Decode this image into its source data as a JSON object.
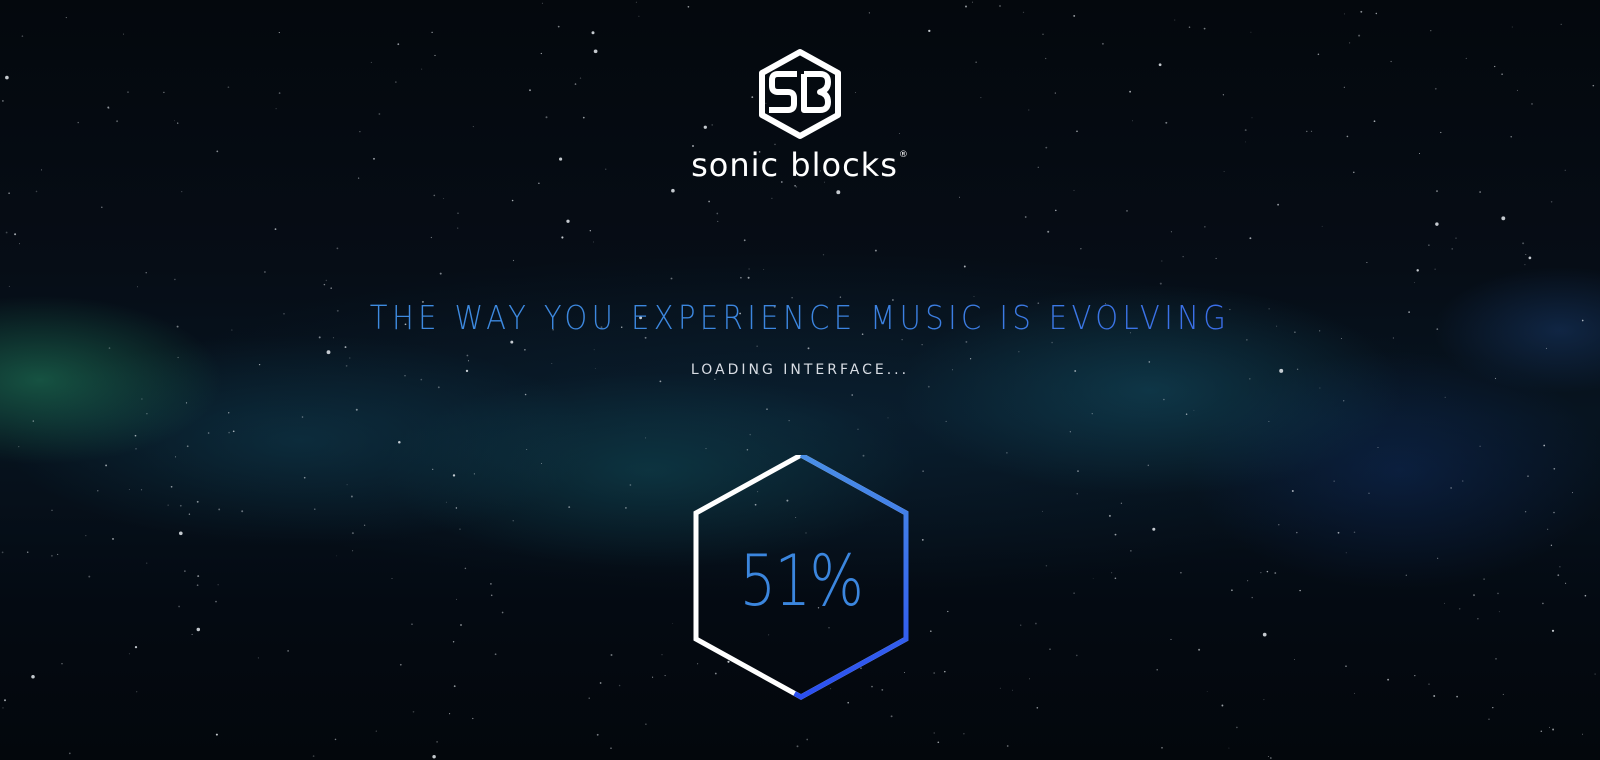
{
  "brand": {
    "logo_icon": "sonic-blocks-hex-logo-icon",
    "logo_monogram": "SB",
    "name": "sonic blocks",
    "registered_mark": "®"
  },
  "headline": "THE WAY YOU EXPERIENCE MUSIC IS EVOLVING",
  "status": "LOADING INTERFACE...",
  "loader": {
    "percent_label": "51%",
    "progress": 0.51,
    "track_color": "#ffffff",
    "progress_color_start": "#4a8fe6",
    "progress_color_end": "#2b4ff0"
  },
  "colors": {
    "background": "#03070c",
    "headline_blue": "#3f8ee0",
    "text_white": "#ffffff"
  }
}
